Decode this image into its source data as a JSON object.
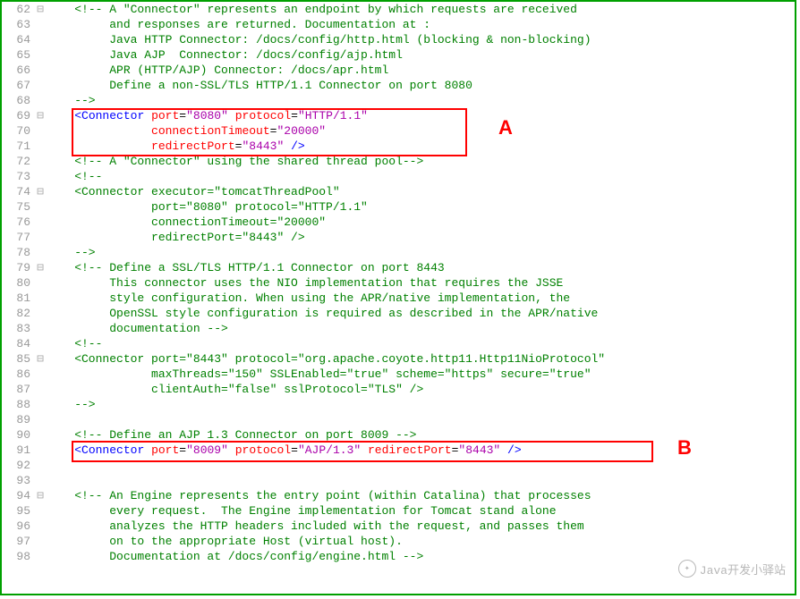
{
  "annotations": {
    "A": "A",
    "B": "B"
  },
  "watermark": "Java开发小驿站",
  "lines": [
    {
      "n": 62,
      "fold": "⊟",
      "seg": [
        {
          "t": "    ",
          "c": ""
        },
        {
          "t": "<!-- A \"Connector\" represents an endpoint by which requests are received",
          "c": "c-cmt"
        }
      ]
    },
    {
      "n": 63,
      "fold": "",
      "seg": [
        {
          "t": "         and responses are returned. Documentation at :",
          "c": "c-cmt"
        }
      ]
    },
    {
      "n": 64,
      "fold": "",
      "seg": [
        {
          "t": "         Java HTTP Connector: /docs/config/http.html (blocking & non-blocking)",
          "c": "c-cmt"
        }
      ]
    },
    {
      "n": 65,
      "fold": "",
      "seg": [
        {
          "t": "         Java AJP  Connector: /docs/config/ajp.html",
          "c": "c-cmt"
        }
      ]
    },
    {
      "n": 66,
      "fold": "",
      "seg": [
        {
          "t": "         APR (HTTP/AJP) Connector: /docs/apr.html",
          "c": "c-cmt"
        }
      ]
    },
    {
      "n": 67,
      "fold": "",
      "seg": [
        {
          "t": "         Define a non-SSL/TLS HTTP/1.1 Connector on port 8080",
          "c": "c-cmt"
        }
      ]
    },
    {
      "n": 68,
      "fold": "",
      "seg": [
        {
          "t": "    -->",
          "c": "c-cmt"
        }
      ]
    },
    {
      "n": 69,
      "fold": "⊟",
      "seg": [
        {
          "t": "    ",
          "c": ""
        },
        {
          "t": "<",
          "c": "c-br"
        },
        {
          "t": "Connector",
          "c": "c-tag"
        },
        {
          "t": " ",
          "c": ""
        },
        {
          "t": "port",
          "c": "c-attr"
        },
        {
          "t": "=",
          "c": ""
        },
        {
          "t": "\"8080\"",
          "c": "c-str"
        },
        {
          "t": " ",
          "c": ""
        },
        {
          "t": "protocol",
          "c": "c-attr"
        },
        {
          "t": "=",
          "c": ""
        },
        {
          "t": "\"HTTP/1.1\"",
          "c": "c-str"
        }
      ]
    },
    {
      "n": 70,
      "fold": "",
      "seg": [
        {
          "t": "               ",
          "c": ""
        },
        {
          "t": "connectionTimeout",
          "c": "c-attr"
        },
        {
          "t": "=",
          "c": ""
        },
        {
          "t": "\"20000\"",
          "c": "c-str"
        }
      ]
    },
    {
      "n": 71,
      "fold": "",
      "seg": [
        {
          "t": "               ",
          "c": ""
        },
        {
          "t": "redirectPort",
          "c": "c-attr"
        },
        {
          "t": "=",
          "c": ""
        },
        {
          "t": "\"8443\"",
          "c": "c-str"
        },
        {
          "t": " />",
          "c": "c-br"
        }
      ]
    },
    {
      "n": 72,
      "fold": "",
      "seg": [
        {
          "t": "    <!-- A \"Connector\" using the shared thread pool-->",
          "c": "c-cmt"
        }
      ]
    },
    {
      "n": 73,
      "fold": "",
      "seg": [
        {
          "t": "    <!--",
          "c": "c-cmt"
        }
      ]
    },
    {
      "n": 74,
      "fold": "⊟",
      "seg": [
        {
          "t": "    <Connector executor=\"tomcatThreadPool\"",
          "c": "c-cmt"
        }
      ]
    },
    {
      "n": 75,
      "fold": "",
      "seg": [
        {
          "t": "               port=\"8080\" protocol=\"HTTP/1.1\"",
          "c": "c-cmt"
        }
      ]
    },
    {
      "n": 76,
      "fold": "",
      "seg": [
        {
          "t": "               connectionTimeout=\"20000\"",
          "c": "c-cmt"
        }
      ]
    },
    {
      "n": 77,
      "fold": "",
      "seg": [
        {
          "t": "               redirectPort=\"8443\" />",
          "c": "c-cmt"
        }
      ]
    },
    {
      "n": 78,
      "fold": "",
      "seg": [
        {
          "t": "    -->",
          "c": "c-cmt"
        }
      ]
    },
    {
      "n": 79,
      "fold": "⊟",
      "seg": [
        {
          "t": "    <!-- Define a SSL/TLS HTTP/1.1 Connector on port 8443",
          "c": "c-cmt"
        }
      ]
    },
    {
      "n": 80,
      "fold": "",
      "seg": [
        {
          "t": "         This connector uses the NIO implementation that requires the JSSE",
          "c": "c-cmt"
        }
      ]
    },
    {
      "n": 81,
      "fold": "",
      "seg": [
        {
          "t": "         style configuration. When using the APR/native implementation, the",
          "c": "c-cmt"
        }
      ]
    },
    {
      "n": 82,
      "fold": "",
      "seg": [
        {
          "t": "         OpenSSL style configuration is required as described in the APR/native",
          "c": "c-cmt"
        }
      ]
    },
    {
      "n": 83,
      "fold": "",
      "seg": [
        {
          "t": "         documentation -->",
          "c": "c-cmt"
        }
      ]
    },
    {
      "n": 84,
      "fold": "",
      "seg": [
        {
          "t": "    <!--",
          "c": "c-cmt"
        }
      ]
    },
    {
      "n": 85,
      "fold": "⊟",
      "seg": [
        {
          "t": "    <Connector port=\"8443\" protocol=\"org.apache.coyote.http11.Http11NioProtocol\"",
          "c": "c-cmt"
        }
      ]
    },
    {
      "n": 86,
      "fold": "",
      "seg": [
        {
          "t": "               maxThreads=\"150\" SSLEnabled=\"true\" scheme=\"https\" secure=\"true\"",
          "c": "c-cmt"
        }
      ]
    },
    {
      "n": 87,
      "fold": "",
      "seg": [
        {
          "t": "               clientAuth=\"false\" sslProtocol=\"TLS\" />",
          "c": "c-cmt"
        }
      ]
    },
    {
      "n": 88,
      "fold": "",
      "seg": [
        {
          "t": "    -->",
          "c": "c-cmt"
        }
      ]
    },
    {
      "n": 89,
      "fold": "",
      "seg": [
        {
          "t": "",
          "c": ""
        }
      ]
    },
    {
      "n": 90,
      "fold": "",
      "seg": [
        {
          "t": "    <!-- Define an AJP 1.3 Connector on port 8009 -->",
          "c": "c-cmt"
        }
      ]
    },
    {
      "n": 91,
      "fold": "",
      "seg": [
        {
          "t": "    ",
          "c": ""
        },
        {
          "t": "<",
          "c": "c-br"
        },
        {
          "t": "Connector",
          "c": "c-tag"
        },
        {
          "t": " ",
          "c": ""
        },
        {
          "t": "port",
          "c": "c-attr"
        },
        {
          "t": "=",
          "c": ""
        },
        {
          "t": "\"8009\"",
          "c": "c-str"
        },
        {
          "t": " ",
          "c": ""
        },
        {
          "t": "protocol",
          "c": "c-attr"
        },
        {
          "t": "=",
          "c": ""
        },
        {
          "t": "\"AJP/1.3\"",
          "c": "c-str"
        },
        {
          "t": " ",
          "c": ""
        },
        {
          "t": "redirectPort",
          "c": "c-attr"
        },
        {
          "t": "=",
          "c": ""
        },
        {
          "t": "\"8443\"",
          "c": "c-str"
        },
        {
          "t": " />",
          "c": "c-br"
        }
      ]
    },
    {
      "n": 92,
      "fold": "",
      "seg": [
        {
          "t": "",
          "c": ""
        }
      ]
    },
    {
      "n": 93,
      "fold": "",
      "seg": [
        {
          "t": "",
          "c": ""
        }
      ]
    },
    {
      "n": 94,
      "fold": "⊟",
      "seg": [
        {
          "t": "    <!-- An Engine represents the entry point (within Catalina) that processes",
          "c": "c-cmt"
        }
      ]
    },
    {
      "n": 95,
      "fold": "",
      "seg": [
        {
          "t": "         every request.  The Engine implementation for Tomcat stand alone",
          "c": "c-cmt"
        }
      ]
    },
    {
      "n": 96,
      "fold": "",
      "seg": [
        {
          "t": "         analyzes the HTTP headers included with the request, and passes them",
          "c": "c-cmt"
        }
      ]
    },
    {
      "n": 97,
      "fold": "",
      "seg": [
        {
          "t": "         on to the appropriate Host (virtual host).",
          "c": "c-cmt"
        }
      ]
    },
    {
      "n": 98,
      "fold": "",
      "seg": [
        {
          "t": "         Documentation at /docs/config/engine.html -->",
          "c": "c-cmt"
        }
      ]
    }
  ]
}
